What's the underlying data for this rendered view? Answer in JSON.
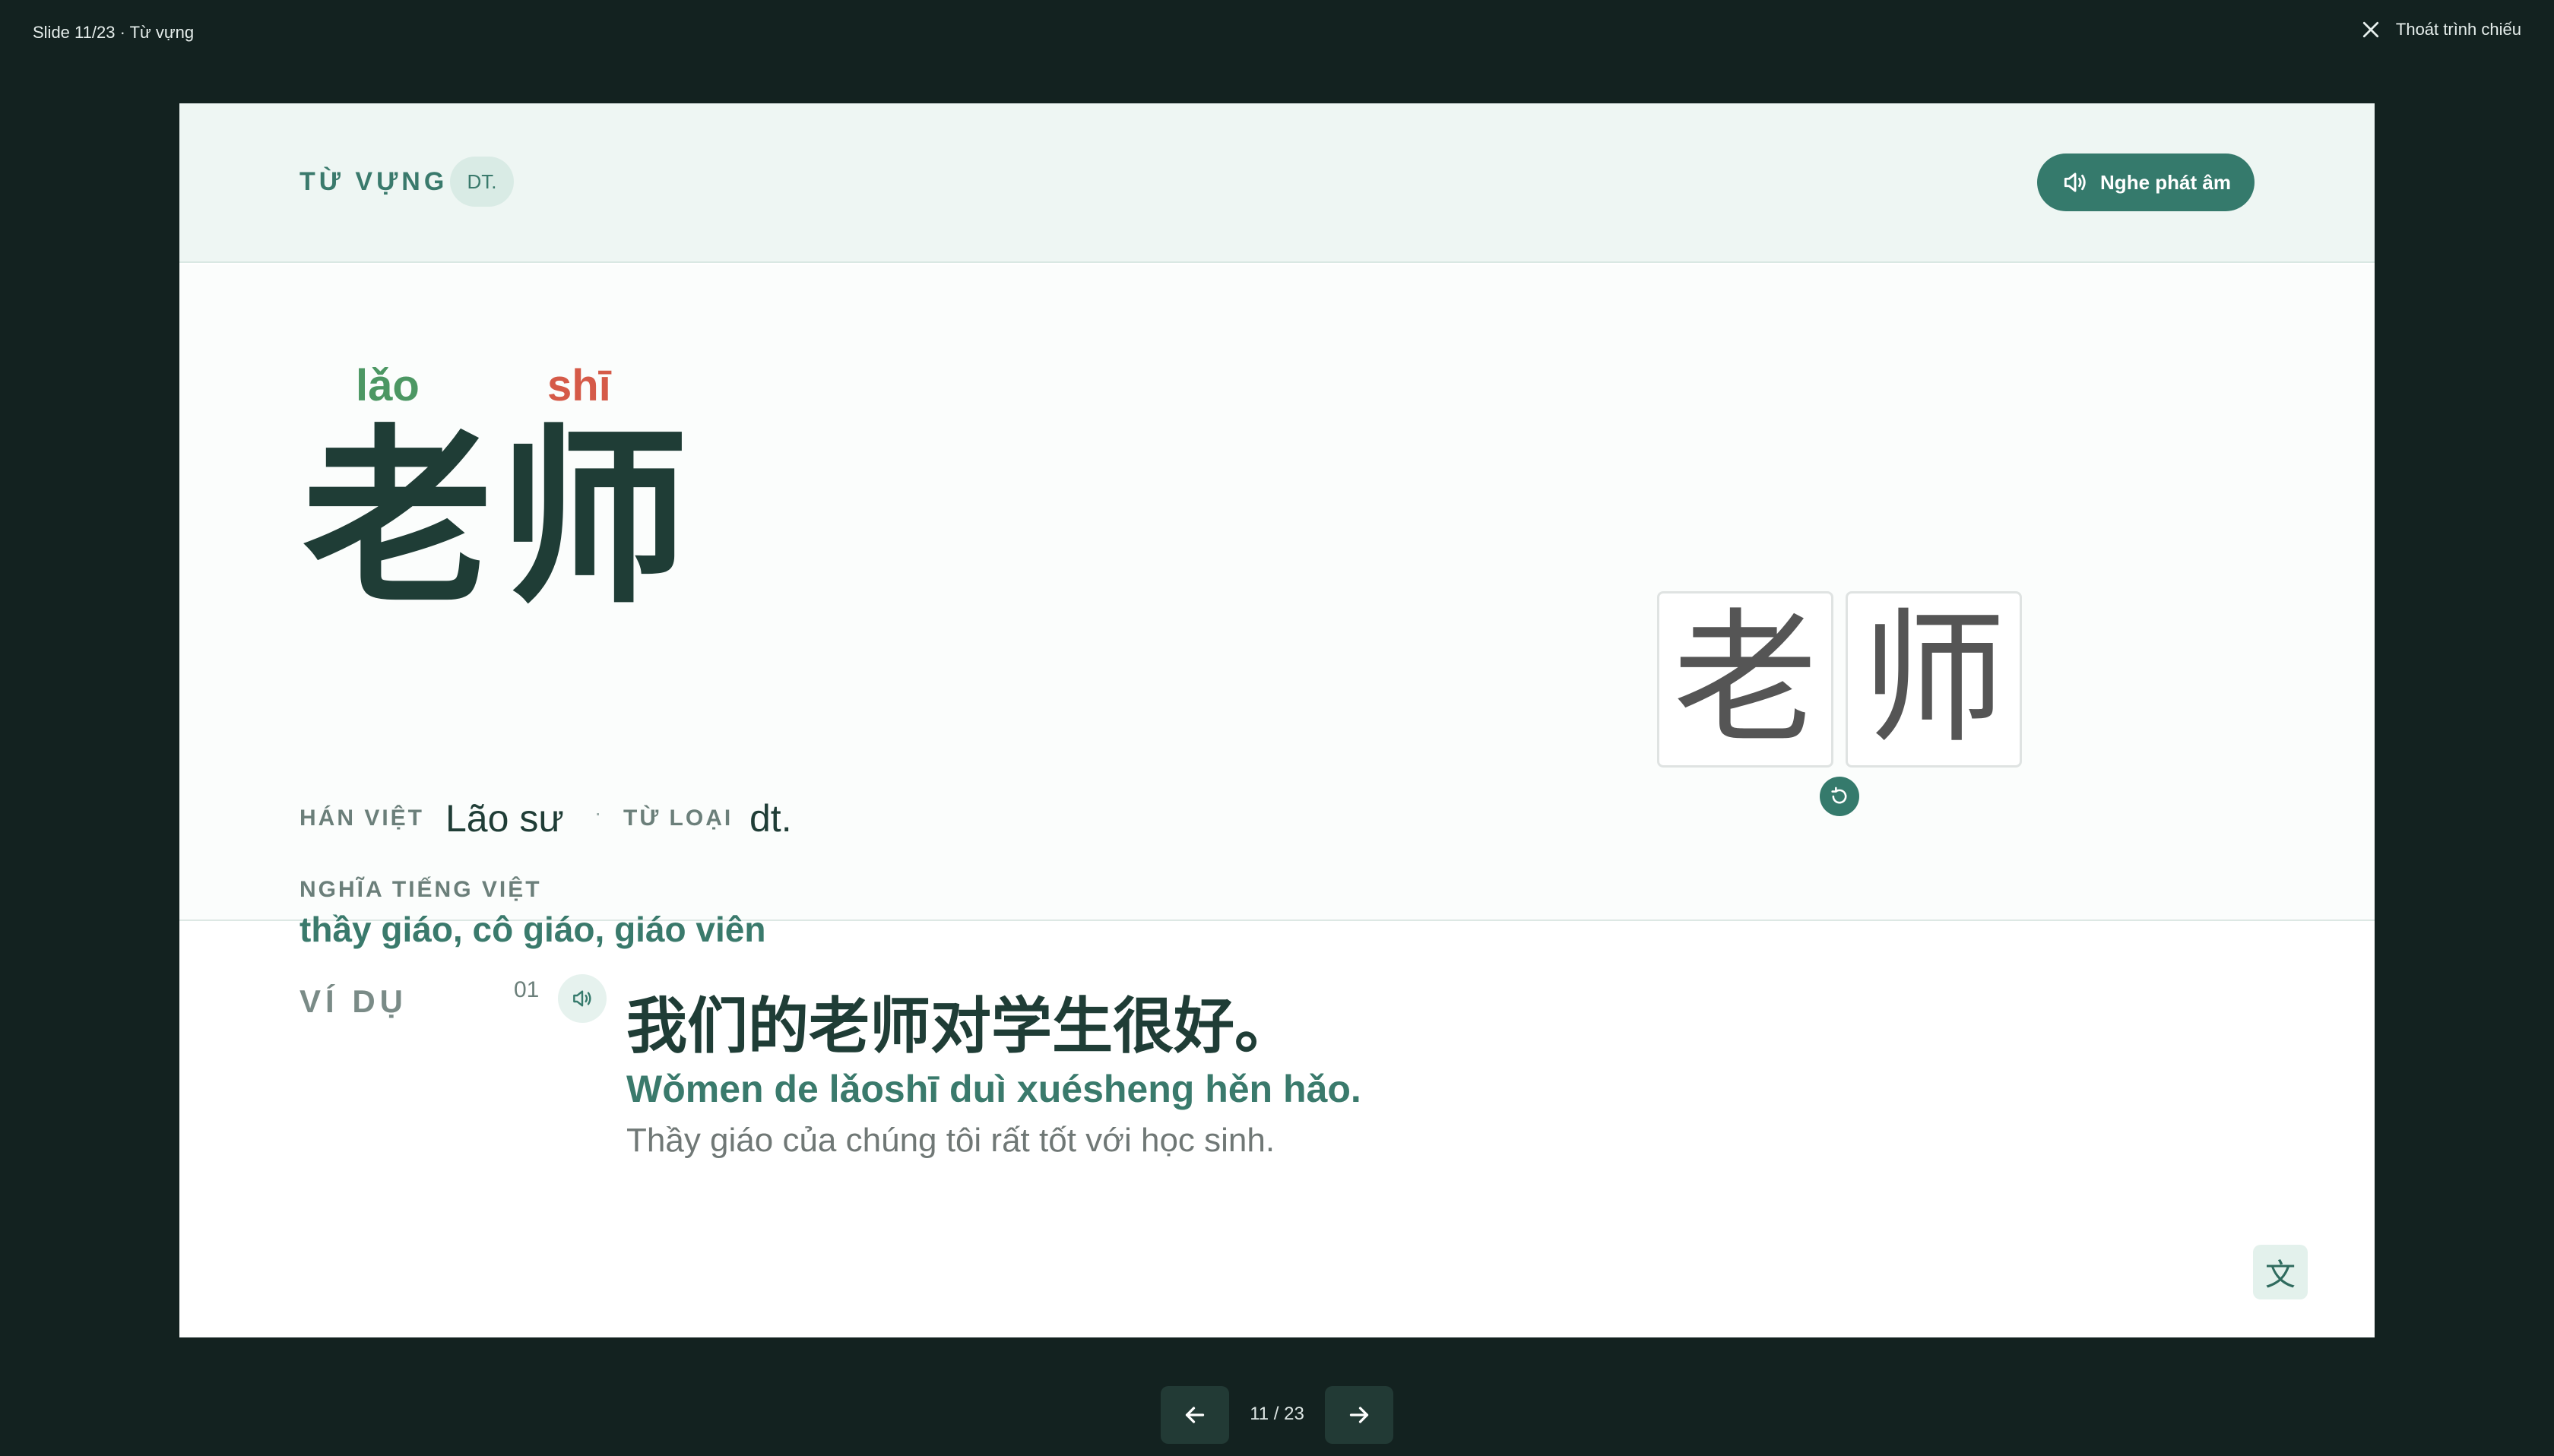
{
  "topbar": {
    "slide_indicator": "Slide 11/23 · Từ vựng",
    "exit_label": "Thoát trình chiếu"
  },
  "header": {
    "section_label": "TỪ VỰNG",
    "pos_badge": "DT.",
    "audio_label": "Nghe phát âm"
  },
  "word": {
    "pinyin": [
      "lǎo",
      "shī"
    ],
    "hanzi": [
      "老",
      "师"
    ],
    "han_viet_label": "HÁN VIỆT",
    "han_viet_value": "Lão sư",
    "separator": "·",
    "pos_label": "TỪ LOẠI",
    "pos_value": "dt.",
    "meaning_label": "NGHĨA TIẾNG VIỆT",
    "meaning_value": "thầy giáo, cô giáo, giáo viên"
  },
  "stroke_order": {
    "characters": [
      "老",
      "师"
    ]
  },
  "examples": {
    "label": "VÍ DỤ",
    "items": [
      {
        "index": "01",
        "hanzi": "我们的老师对学生很好。",
        "pinyin": "Wǒmen de lǎoshī duì xuésheng hěn hǎo.",
        "translation": "Thầy giáo của chúng tôi rất tốt với học sinh."
      }
    ]
  },
  "translate_toggle": "文",
  "nav": {
    "counter": "11 / 23"
  },
  "colors": {
    "background": "#132220",
    "accent": "#357a6c",
    "tone3": "#4c9763",
    "tone1": "#d55a48"
  }
}
